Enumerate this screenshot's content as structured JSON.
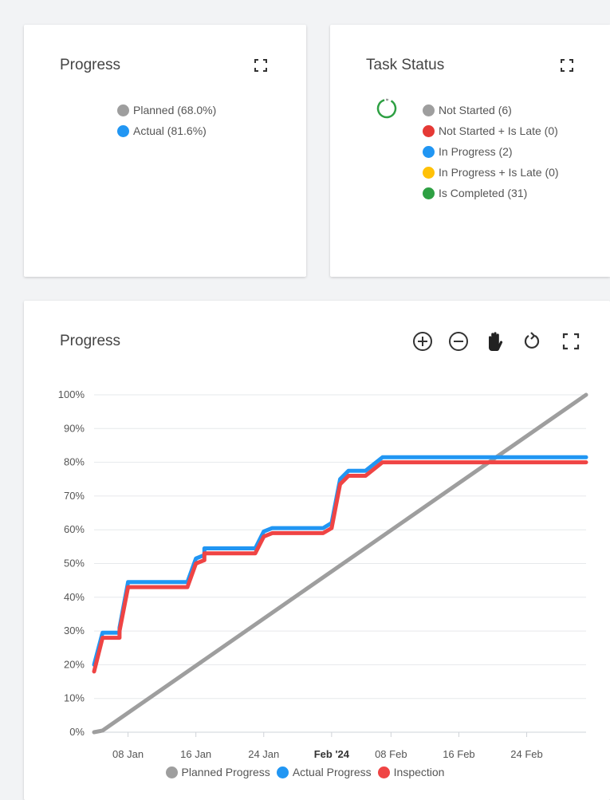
{
  "cards": {
    "progress_summary": {
      "title": "Progress",
      "legend": [
        {
          "label": "Planned (68.0%)",
          "color": "#9e9e9e"
        },
        {
          "label": "Actual (81.6%)",
          "color": "#2196f3"
        }
      ]
    },
    "task_status": {
      "title": "Task Status",
      "legend": [
        {
          "label": "Not Started (6)",
          "color": "#9e9e9e"
        },
        {
          "label": "Not Started + Is Late (0)",
          "color": "#e53935"
        },
        {
          "label": "In Progress (2)",
          "color": "#2196f3"
        },
        {
          "label": "In Progress + Is Late (0)",
          "color": "#ffc107"
        },
        {
          "label": "Is Completed (31)",
          "color": "#2ea043"
        }
      ],
      "donut_icon": "donut-chart-icon"
    },
    "progress_chart": {
      "title": "Progress",
      "toolbar": [
        "zoom-in-icon",
        "zoom-out-icon",
        "pan-hand-icon",
        "reset-icon",
        "fullscreen-icon"
      ]
    }
  },
  "chart_data": {
    "type": "line",
    "title": "Progress",
    "xlabel": "",
    "ylabel": "",
    "ylim": [
      0,
      100
    ],
    "y_ticks": [
      "0%",
      "10%",
      "20%",
      "30%",
      "40%",
      "50%",
      "60%",
      "70%",
      "80%",
      "90%",
      "100%"
    ],
    "x_range": [
      "2024-01-04",
      "2024-03-02"
    ],
    "x_ticks": [
      {
        "date": "2024-01-08",
        "label": "08 Jan",
        "bold": false
      },
      {
        "date": "2024-01-16",
        "label": "16 Jan",
        "bold": false
      },
      {
        "date": "2024-01-24",
        "label": "24 Jan",
        "bold": false
      },
      {
        "date": "2024-02-01",
        "label": "Feb '24",
        "bold": true
      },
      {
        "date": "2024-02-08",
        "label": "08 Feb",
        "bold": false
      },
      {
        "date": "2024-02-16",
        "label": "16 Feb",
        "bold": false
      },
      {
        "date": "2024-02-24",
        "label": "24 Feb",
        "bold": false
      }
    ],
    "grid": true,
    "legend_position": "bottom",
    "series": [
      {
        "name": "Planned Progress",
        "color": "#9e9e9e",
        "points": [
          [
            "2024-01-04",
            0
          ],
          [
            "2024-01-05",
            0.5
          ],
          [
            "2024-03-02",
            100
          ]
        ]
      },
      {
        "name": "Actual Progress",
        "color": "#2196f3",
        "points": [
          [
            "2024-01-04",
            20
          ],
          [
            "2024-01-05",
            29.5
          ],
          [
            "2024-01-07",
            29.5
          ],
          [
            "2024-01-07",
            31
          ],
          [
            "2024-01-08",
            44.5
          ],
          [
            "2024-01-15",
            44.5
          ],
          [
            "2024-01-16",
            51.5
          ],
          [
            "2024-01-17",
            52.5
          ],
          [
            "2024-01-17",
            54.5
          ],
          [
            "2024-01-23",
            54.5
          ],
          [
            "2024-01-24",
            59.5
          ],
          [
            "2024-01-25",
            60.5
          ],
          [
            "2024-01-31",
            60.5
          ],
          [
            "2024-02-01",
            62
          ],
          [
            "2024-02-02",
            75
          ],
          [
            "2024-02-03",
            77.5
          ],
          [
            "2024-02-05",
            77.5
          ],
          [
            "2024-02-07",
            81.5
          ],
          [
            "2024-03-02",
            81.5
          ]
        ]
      },
      {
        "name": "Inspection",
        "color": "#ef4444",
        "points": [
          [
            "2024-01-04",
            18
          ],
          [
            "2024-01-05",
            28
          ],
          [
            "2024-01-07",
            28
          ],
          [
            "2024-01-07",
            30
          ],
          [
            "2024-01-08",
            43
          ],
          [
            "2024-01-15",
            43
          ],
          [
            "2024-01-16",
            50
          ],
          [
            "2024-01-17",
            51
          ],
          [
            "2024-01-17",
            53
          ],
          [
            "2024-01-23",
            53
          ],
          [
            "2024-01-24",
            58
          ],
          [
            "2024-01-25",
            59
          ],
          [
            "2024-01-31",
            59
          ],
          [
            "2024-02-01",
            60.5
          ],
          [
            "2024-02-02",
            73.5
          ],
          [
            "2024-02-03",
            76
          ],
          [
            "2024-02-05",
            76
          ],
          [
            "2024-02-07",
            80
          ],
          [
            "2024-03-02",
            80
          ]
        ]
      }
    ]
  }
}
